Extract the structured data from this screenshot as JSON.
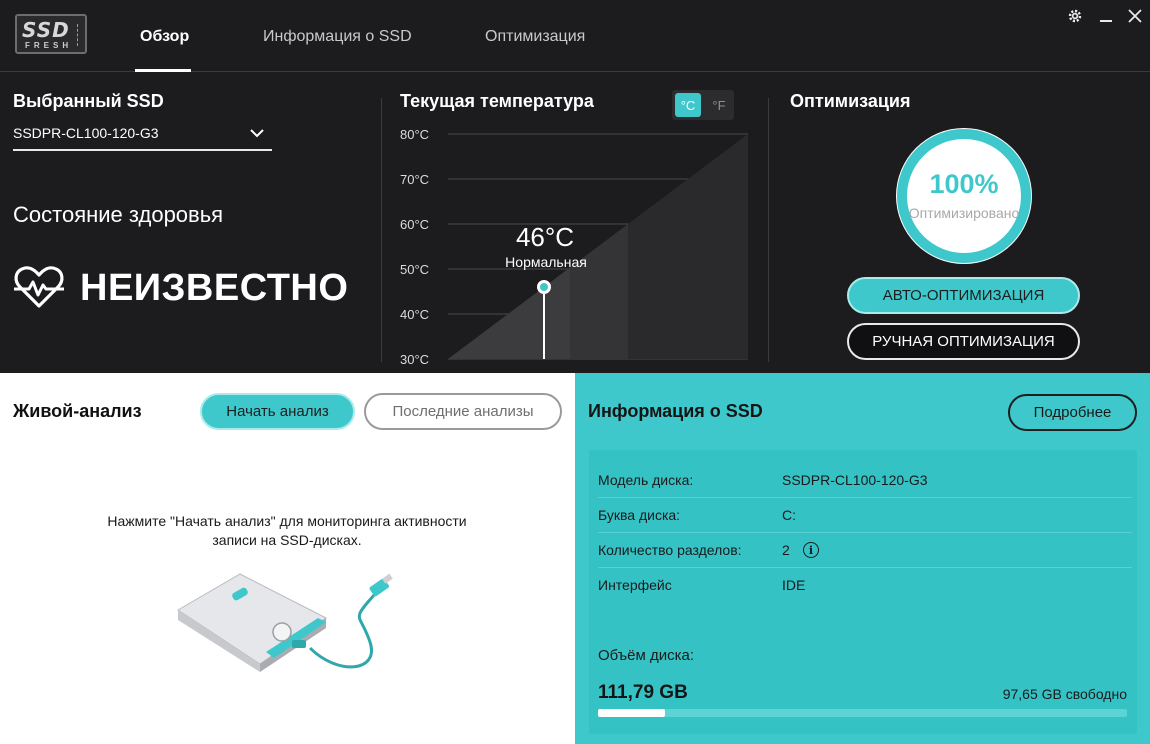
{
  "app": {
    "logo_top": "SSD",
    "logo_bottom": "FRESH",
    "tabs": [
      {
        "label": "Обзор",
        "active": true
      },
      {
        "label": "Информация о SSD",
        "active": false
      },
      {
        "label": "Оптимизация",
        "active": false
      }
    ],
    "window_buttons": [
      "gear-icon",
      "minimize-icon",
      "close-icon"
    ]
  },
  "selected_ssd": {
    "title": "Выбранный SSD",
    "value": "SSDPR-CL100-120-G3"
  },
  "health": {
    "label": "Состояние здоровья",
    "value": "НЕИЗВЕСТНО"
  },
  "temperature": {
    "title": "Текущая температура",
    "unit_c": "°C",
    "unit_f": "°F",
    "active_unit": "C",
    "ticks": [
      "80°C",
      "70°C",
      "60°C",
      "50°C",
      "40°C",
      "30°C"
    ],
    "value": "46°C",
    "status": "Нормальная",
    "current": 46,
    "range": [
      30,
      80
    ]
  },
  "optimization": {
    "title": "Оптимизация",
    "percent": "100%",
    "percent_value": 100,
    "status": "Оптимизировано",
    "auto_button": "АВТО-ОПТИМИЗАЦИЯ",
    "manual_button": "РУЧНАЯ ОПТИМИЗАЦИЯ"
  },
  "live_analysis": {
    "title": "Живой-анализ",
    "start_button": "Начать анализ",
    "recent_button": "Последние анализы",
    "message_line1": "Нажмите \"Начать анализ\" для мониторинга активности",
    "message_line2": "записи на SSD-дисках."
  },
  "ssd_info": {
    "title": "Информация о SSD",
    "more_button": "Подробнее",
    "rows": [
      {
        "key": "Модель диска:",
        "value": "SSDPR-CL100-120-G3"
      },
      {
        "key": "Буква диска:",
        "value": "C:"
      },
      {
        "key": "Количество разделов:",
        "value": "2"
      },
      {
        "key": "Интерфейс",
        "value": "IDE"
      }
    ],
    "info_icon": "i",
    "capacity_label": "Объём диска:",
    "capacity_total": "111,79 GB",
    "capacity_free": "97,65 GB свободно",
    "used_fraction": 0.1265
  },
  "colors": {
    "accent": "#3ec8cb",
    "dark_bg": "#1c1b1d",
    "panel": "#35c2c5"
  }
}
